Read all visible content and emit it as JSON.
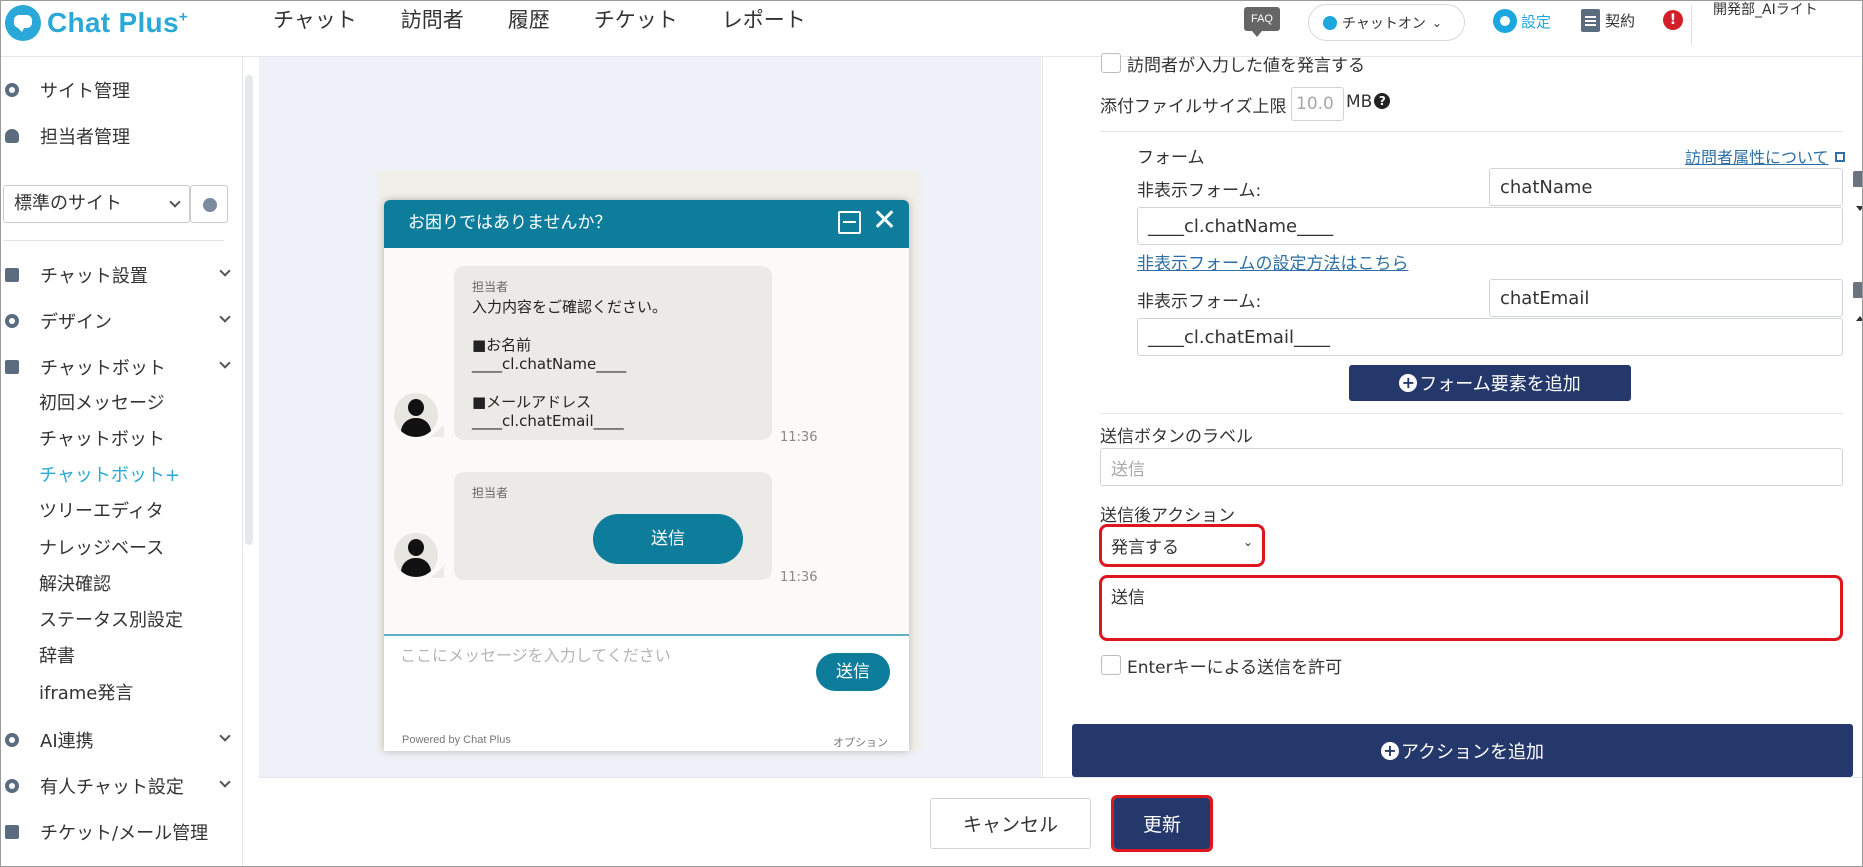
{
  "header": {
    "logo_text": "Chat Plus",
    "logo_sup": "+",
    "nav": [
      "チャット",
      "訪問者",
      "履歴",
      "チケット",
      "レポート"
    ],
    "faq_label": "FAQ",
    "status_label": "チャットオン",
    "settings_label": "設定",
    "contract_label": "契約",
    "alert_glyph": "!",
    "user_name": "開発部_AIライト"
  },
  "sidebar": {
    "site_management": "サイト管理",
    "staff_management": "担当者管理",
    "site_select_value": "標準のサイト",
    "sections": [
      {
        "label": "チャット設置"
      },
      {
        "label": "デザイン"
      },
      {
        "label": "チャットボット"
      }
    ],
    "chatbot_items": [
      "初回メッセージ",
      "チャットボット",
      "チャットボット+",
      "ツリーエディタ",
      "ナレッジベース",
      "解決確認",
      "ステータス別設定",
      "辞書",
      "iframe発言"
    ],
    "bottom_sections": [
      {
        "label": "AI連携"
      },
      {
        "label": "有人チャット設定"
      },
      {
        "label": "チケット/メール管理"
      }
    ]
  },
  "widget": {
    "title": "お困りではありませんか？",
    "msg1": {
      "sender": "担当者",
      "lines": [
        "入力内容をご確認ください。",
        "",
        "■お名前",
        "____cl.chatName____",
        "",
        "■メールアドレス",
        "____cl.chatEmail____"
      ],
      "time": "11:36"
    },
    "msg2": {
      "sender": "担当者",
      "button_label": "送信",
      "time": "11:36"
    },
    "input_placeholder": "ここにメッセージを入力してください",
    "send_label": "送信",
    "powered_by": "Powered by Chat Plus",
    "option_label": "オプション"
  },
  "panel": {
    "speak_visitor_input_label": "訪問者が入力した値を発言する",
    "attach_size_label": "添付ファイルサイズ上限",
    "attach_size_value": "10.0",
    "attach_size_unit": "MB",
    "form_label": "フォーム",
    "visitor_attr_link": "訪問者属性について",
    "hidden_form_label": "非表示フォーム:",
    "hidden_forms": [
      {
        "name": "chatName",
        "value": "____cl.chatName____"
      },
      {
        "name": "chatEmail",
        "value": "____cl.chatEmail____"
      }
    ],
    "hidden_form_help_link": "非表示フォームの設定方法はこちら",
    "add_form_element_label": "フォーム要素を追加",
    "send_button_label_title": "送信ボタンのラベル",
    "send_button_label_placeholder": "送信",
    "after_send_action_title": "送信後アクション",
    "after_send_action_value": "発言する",
    "after_send_text": "送信",
    "enter_key_label": "Enterキーによる送信を許可",
    "add_action_label": "アクションを追加"
  },
  "footer": {
    "cancel_label": "キャンセル",
    "update_label": "更新"
  },
  "colors": {
    "brand": "#2aa8d7",
    "widget_teal": "#0e7d9c",
    "navy": "#24386b",
    "highlight_red": "#e0161e"
  }
}
